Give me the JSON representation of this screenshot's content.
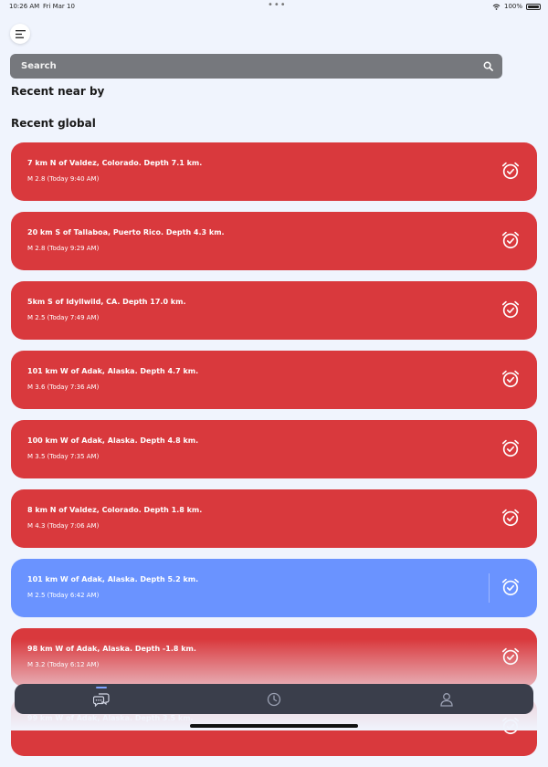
{
  "status_bar": {
    "time": "10:26 AM",
    "date": "Fri Mar 10",
    "battery": "100%"
  },
  "search": {
    "placeholder": "Search"
  },
  "sections": {
    "nearby": "Recent near by",
    "global": "Recent global"
  },
  "quakes": [
    {
      "title": "7 km N of Valdez, Colorado. Depth 7.1 km.",
      "sub": "M 2.8 (Today 9:40 AM)",
      "color": "#d9393d"
    },
    {
      "title": "20 km S of Tallaboa, Puerto Rico. Depth 4.3 km.",
      "sub": "M 2.8 (Today 9:29 AM)",
      "color": "#d9393d"
    },
    {
      "title": "5km S of Idyllwild, CA. Depth 17.0 km.",
      "sub": "M 2.5 (Today 7:49 AM)",
      "color": "#d9393d"
    },
    {
      "title": "101 km W of Adak, Alaska. Depth 4.7 km.",
      "sub": "M 3.6 (Today 7:36 AM)",
      "color": "#d9393d"
    },
    {
      "title": "100 km W of Adak, Alaska. Depth 4.8 km.",
      "sub": "M 3.5 (Today 7:35 AM)",
      "color": "#d9393d"
    },
    {
      "title": "8 km N of Valdez, Colorado. Depth 1.8 km.",
      "sub": "M 4.3 (Today 7:06 AM)",
      "color": "#d9393d"
    },
    {
      "title": "101 km W of Adak, Alaska. Depth 5.2 km.",
      "sub": "M 2.5 (Today 6:42 AM)",
      "color": "#6a93ff"
    },
    {
      "title": "98 km W of Adak, Alaska. Depth -1.8 km.",
      "sub": "M 3.2 (Today 6:12 AM)",
      "color": "#d9393d"
    },
    {
      "title": "99 km W of Adak, Alaska. Depth 3.5 km.",
      "sub": "",
      "color": "#d9393d"
    }
  ],
  "tabs": [
    {
      "icon": "chat-icon",
      "active": true
    },
    {
      "icon": "clock-icon",
      "active": false
    },
    {
      "icon": "profile-icon",
      "active": false
    }
  ]
}
